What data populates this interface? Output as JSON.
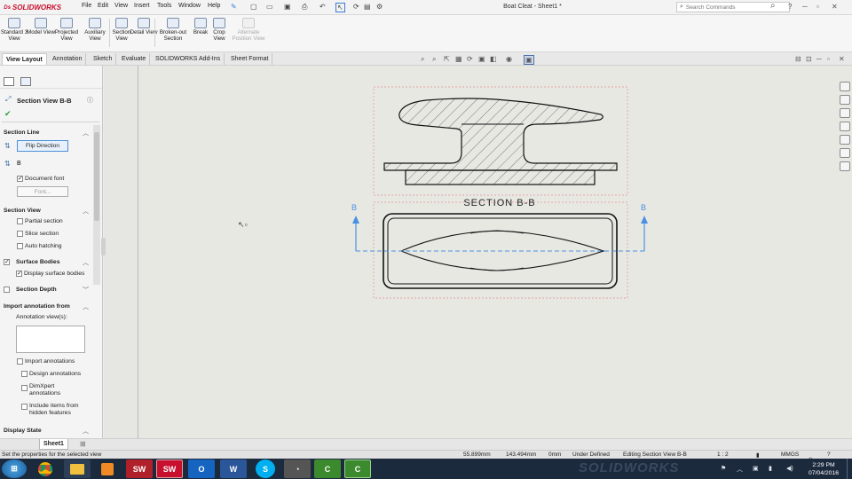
{
  "titlebar": {
    "app_name": "SOLIDWORKS",
    "document_title": "Boat Cleat - Sheet1 *",
    "menus": [
      "File",
      "Edit",
      "View",
      "Insert",
      "Tools",
      "Window",
      "Help"
    ],
    "search_placeholder": "Search Commands"
  },
  "ribbon": {
    "buttons": [
      {
        "label": "Standard 3 View"
      },
      {
        "label": "Model View"
      },
      {
        "label": "Projected View"
      },
      {
        "label": "Auxiliary View"
      },
      {
        "label": "Section View"
      },
      {
        "label": "Detail View"
      },
      {
        "label": "Broken-out Section"
      },
      {
        "label": "Break"
      },
      {
        "label": "Crop View"
      },
      {
        "label": "Alternate Position View"
      }
    ]
  },
  "tabs": [
    "View Layout",
    "Annotation",
    "Sketch",
    "Evaluate",
    "SOLIDWORKS Add-Ins",
    "Sheet Format"
  ],
  "property_manager": {
    "title": "Section View B-B",
    "section_line": {
      "header": "Section Line",
      "flip_button": "Flip Direction",
      "label_value": "B",
      "document_font": "Document font",
      "font_button": "Font..."
    },
    "section_view": {
      "header": "Section View",
      "partial_section": "Partial section",
      "slice_section": "Slice section",
      "auto_hatching": "Auto hatching"
    },
    "surface_bodies": {
      "header": "Surface Bodies",
      "display_surface_bodies": "Display surface bodies"
    },
    "section_depth": {
      "header": "Section Depth"
    },
    "import_annotation": {
      "header": "Import annotation from",
      "views_label": "Annotation view(s):",
      "import_annotations": "Import annotations",
      "design_annotations": "Design annotations",
      "dimxpert_annotations": "DimXpert annotations",
      "include_hidden": "Include items from hidden features"
    },
    "display_state": {
      "header": "Display State"
    }
  },
  "drawing": {
    "section_title": "SECTION B-B",
    "section_label_left": "B",
    "section_label_right": "B",
    "watermark": "SOLIDWORKS"
  },
  "sheet_tab": "Sheet1",
  "status": {
    "hint": "Set the properties for the selected view",
    "x": "55.899mm",
    "y": "143.494mm",
    "z": "0mm",
    "definition": "Under Defined",
    "mode": "Editing Section View B-B",
    "scale": "1 : 2",
    "units": "MMGS"
  },
  "taskbar": {
    "time": "2:29 PM",
    "date": "07/04/2016"
  },
  "colors": {
    "accent_blue": "#4a90e2",
    "brand_red": "#c8102e",
    "taskbar": "#1c2a3e"
  }
}
